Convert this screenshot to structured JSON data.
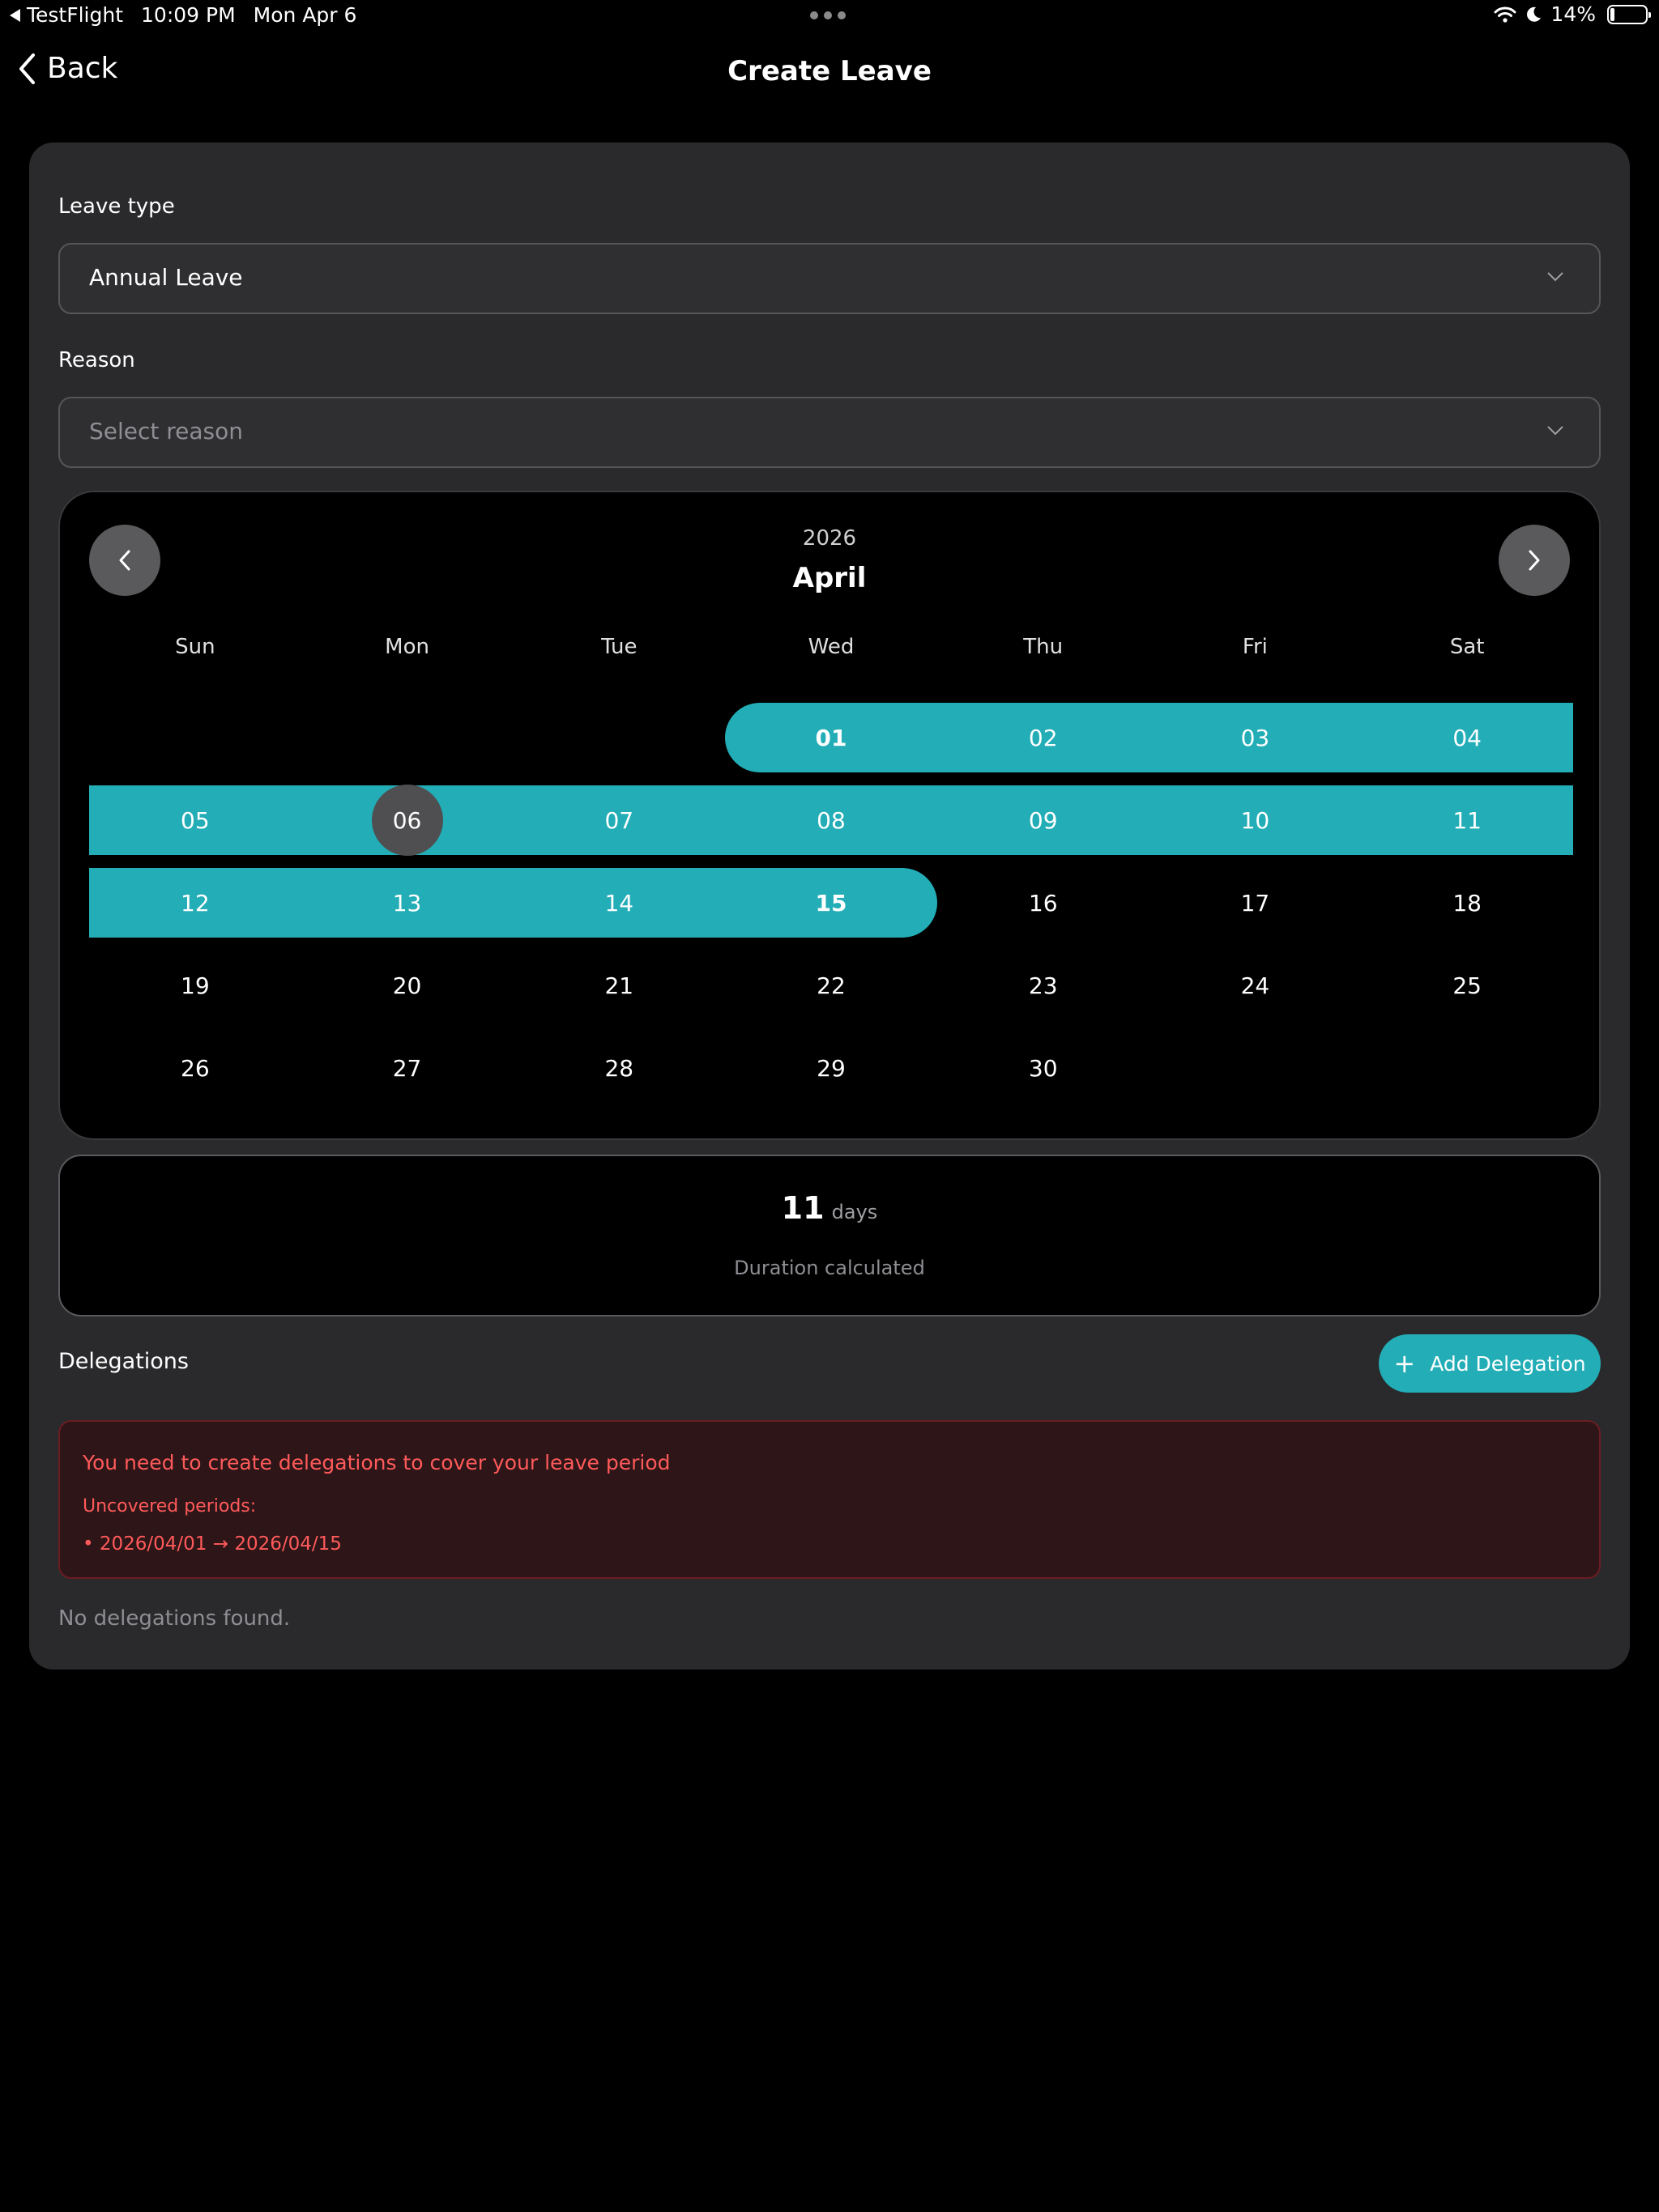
{
  "status_bar": {
    "app": "TestFlight",
    "time": "10:09 PM",
    "date": "Mon Apr 6",
    "battery": "14%",
    "battery_level": 0.14
  },
  "nav": {
    "back_label": "Back",
    "title": "Create Leave"
  },
  "form": {
    "leave_type_label": "Leave type",
    "leave_type_value": "Annual Leave",
    "reason_label": "Reason",
    "reason_placeholder": "Select reason"
  },
  "calendar": {
    "year": "2026",
    "month": "April",
    "weekdays": [
      "Sun",
      "Mon",
      "Tue",
      "Wed",
      "Thu",
      "Fri",
      "Sat"
    ],
    "first_weekday_index": 3,
    "days": [
      "01",
      "02",
      "03",
      "04",
      "05",
      "06",
      "07",
      "08",
      "09",
      "10",
      "11",
      "12",
      "13",
      "14",
      "15",
      "16",
      "17",
      "18",
      "19",
      "20",
      "21",
      "22",
      "23",
      "24",
      "25",
      "26",
      "27",
      "28",
      "29",
      "30"
    ],
    "range_start": 1,
    "range_end": 15,
    "today": 6,
    "accent": "#23adb7"
  },
  "duration": {
    "count": "11",
    "unit": "days",
    "caption": "Duration calculated"
  },
  "delegations": {
    "title": "Delegations",
    "add_label": "Add Delegation",
    "alert_title": "You need to create delegations to cover your leave period",
    "alert_subtitle": "Uncovered periods:",
    "uncovered": [
      "• 2026/04/01 → 2026/04/15"
    ],
    "empty_text": "No delegations found.",
    "alert_color": "#ff5a5a"
  }
}
